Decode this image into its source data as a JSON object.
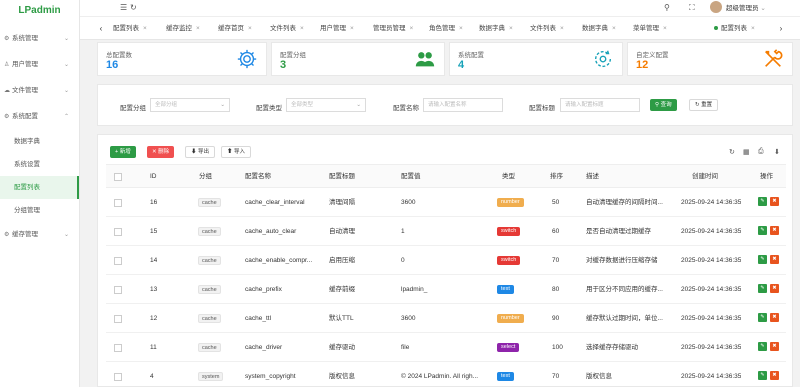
{
  "app": {
    "logo": "LPadmin"
  },
  "sidebar": {
    "items": [
      {
        "label": "系统管理",
        "icon": "gear-icon"
      },
      {
        "label": "用户管理",
        "icon": "user-icon"
      },
      {
        "label": "文件管理",
        "icon": "cloud-icon"
      },
      {
        "label": "系统配置",
        "icon": "gear-icon"
      }
    ],
    "sub": [
      {
        "label": "数据字典"
      },
      {
        "label": "系统设置"
      },
      {
        "label": "配置列表"
      },
      {
        "label": "分组管理"
      }
    ],
    "cache": {
      "label": "缓存管理"
    }
  },
  "topbar": {
    "user": "超级管理员"
  },
  "tabs": [
    {
      "label": "配置列表",
      "active": false
    },
    {
      "label": "缓存监控",
      "active": false
    },
    {
      "label": "缓存首页",
      "active": false
    },
    {
      "label": "文件列表",
      "active": false
    },
    {
      "label": "用户管理",
      "active": false
    },
    {
      "label": "管理员管理",
      "active": false
    },
    {
      "label": "角色管理",
      "active": false
    },
    {
      "label": "数据字典",
      "active": false
    },
    {
      "label": "文件列表",
      "active": false
    },
    {
      "label": "数据字典",
      "active": false
    },
    {
      "label": "菜单管理",
      "active": false
    },
    {
      "label": "配置列表",
      "active": true
    }
  ],
  "stats": [
    {
      "label": "总配置数",
      "value": "16",
      "color": "#1e88e5",
      "icon": "gear-icon"
    },
    {
      "label": "配置分组",
      "value": "3",
      "color": "#2d9b45",
      "icon": "users-icon"
    },
    {
      "label": "系统配置",
      "value": "4",
      "color": "#17a2b8",
      "icon": "refresh-gear-icon"
    },
    {
      "label": "自定义配置",
      "value": "12",
      "color": "#f57c00",
      "icon": "tools-icon"
    }
  ],
  "filter": {
    "group_label": "配置分组",
    "group_placeholder": "全部分组",
    "type_label": "配置类型",
    "type_placeholder": "全部类型",
    "name_label": "配置名称",
    "name_placeholder": "请输入配置名称",
    "title_label": "配置标题",
    "title_placeholder": "请输入配置标题",
    "search": "查询",
    "reset": "重置"
  },
  "toolbar": {
    "add": "新增",
    "delete": "删除",
    "export": "导出",
    "import": "导入"
  },
  "table": {
    "headers": {
      "id": "ID",
      "group": "分组",
      "name": "配置名称",
      "title": "配置标题",
      "value": "配置值",
      "type": "类型",
      "sort": "排序",
      "desc": "描述",
      "created": "创建时间",
      "action": "操作"
    },
    "rows": [
      {
        "id": "16",
        "group": "cache",
        "name": "cache_clear_interval",
        "title": "清理间隔",
        "value": "3600",
        "type": "number",
        "type_color": "#f0ad4e",
        "sort": "50",
        "desc": "自动清理缓存的间隔时间...",
        "created": "2025-09-24 14:36:35"
      },
      {
        "id": "15",
        "group": "cache",
        "name": "cache_auto_clear",
        "title": "自动清理",
        "value": "1",
        "type": "switch",
        "type_color": "#e53935",
        "sort": "60",
        "desc": "是否自动清理过期缓存",
        "created": "2025-09-24 14:36:35"
      },
      {
        "id": "14",
        "group": "cache",
        "name": "cache_enable_compr...",
        "title": "启用压缩",
        "value": "0",
        "type": "switch",
        "type_color": "#e53935",
        "sort": "70",
        "desc": "对缓存数据进行压缩存储",
        "created": "2025-09-24 14:36:35"
      },
      {
        "id": "13",
        "group": "cache",
        "name": "cache_prefix",
        "title": "缓存前缀",
        "value": "lpadmin_",
        "type": "text",
        "type_color": "#1e88e5",
        "sort": "80",
        "desc": "用于区分不同应用的缓存...",
        "created": "2025-09-24 14:36:35"
      },
      {
        "id": "12",
        "group": "cache",
        "name": "cache_ttl",
        "title": "默认TTL",
        "value": "3600",
        "type": "number",
        "type_color": "#f0ad4e",
        "sort": "90",
        "desc": "缓存默认过期时间，单位...",
        "created": "2025-09-24 14:36:35"
      },
      {
        "id": "11",
        "group": "cache",
        "name": "cache_driver",
        "title": "缓存驱动",
        "value": "file",
        "type": "select",
        "type_color": "#8e24aa",
        "sort": "100",
        "desc": "选择缓存存储驱动",
        "created": "2025-09-24 14:36:35"
      },
      {
        "id": "4",
        "group": "system",
        "name": "system_copyright",
        "title": "版权信息",
        "value": "© 2024 LPadmin. All righ...",
        "type": "text",
        "type_color": "#1e88e5",
        "sort": "70",
        "desc": "版权信息",
        "created": "2025-09-24 14:36:35"
      }
    ]
  }
}
